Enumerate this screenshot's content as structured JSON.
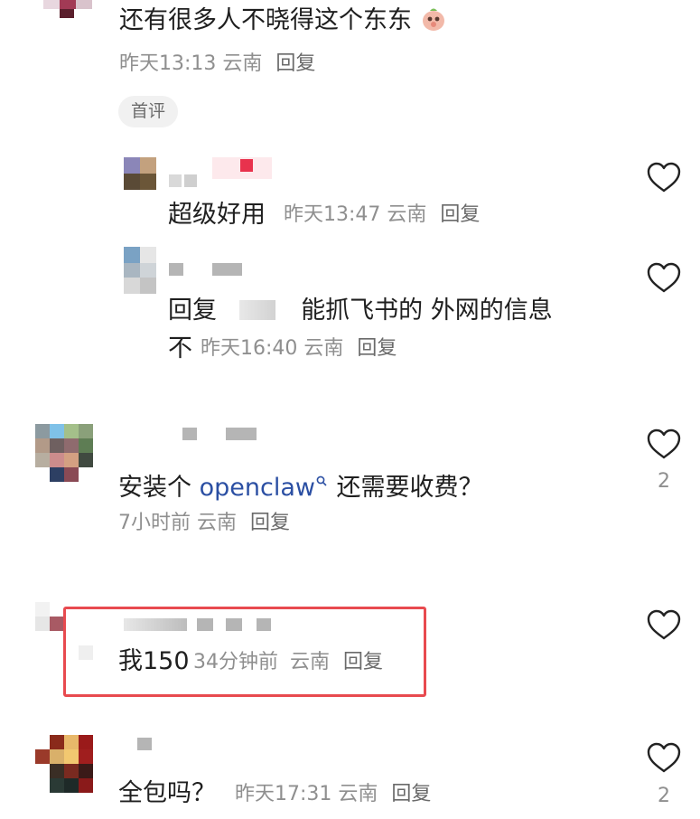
{
  "comments": [
    {
      "text": "还有很多人不晓得这个东东",
      "emoji": "emoji-cute",
      "time": "昨天13:13",
      "location": "云南",
      "reply": "回复",
      "badge": "首评"
    },
    {
      "text": "超级好用",
      "time": "昨天13:47",
      "location": "云南",
      "reply": "回复"
    },
    {
      "text_prefix": "回复",
      "text_main": "能抓飞书的 外网的信息",
      "text_line2": "不",
      "time": "昨天16:40",
      "location": "云南",
      "reply": "回复"
    },
    {
      "text_before": "安装个",
      "link": "openclaw",
      "text_after": "还需要收费？",
      "time": "7小时前",
      "location": "云南",
      "reply": "回复",
      "likes": "2"
    },
    {
      "text": "我150",
      "time": "34分钟前",
      "location": "云南",
      "reply": "回复"
    },
    {
      "text": "全包吗？",
      "time": "昨天17:31",
      "location": "云南",
      "reply": "回复",
      "likes": "2"
    }
  ],
  "icons": {
    "heart": "heart-outline-icon",
    "search": "search-icon"
  },
  "colors": {
    "highlight": "#e84a4f",
    "link": "#2b4fa3"
  }
}
